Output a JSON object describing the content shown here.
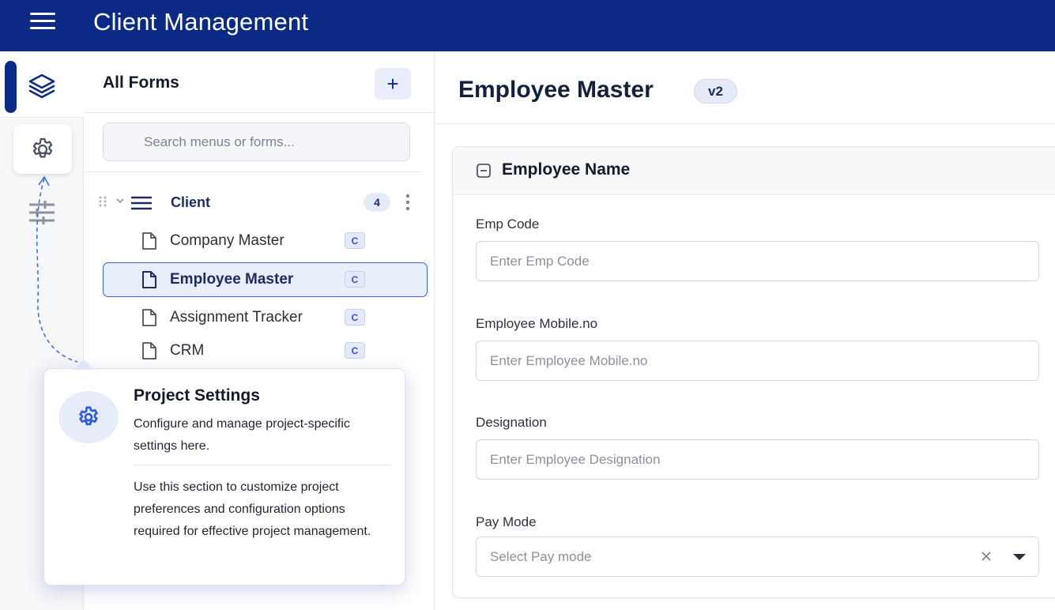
{
  "app": {
    "title": "Client Management"
  },
  "forms_panel": {
    "title": "All Forms",
    "add_label": "+",
    "search_placeholder": "Search menus or forms...",
    "group": {
      "label": "Client",
      "count": "4"
    },
    "items": [
      {
        "label": "Company Master",
        "badge": "C"
      },
      {
        "label": "Employee Master",
        "badge": "C",
        "active": true
      },
      {
        "label": "Assignment Tracker",
        "badge": "C"
      },
      {
        "label": "CRM",
        "badge": "C"
      }
    ]
  },
  "main": {
    "title": "Employee Master",
    "version": "v2",
    "section_title": "Employee Name",
    "fields": [
      {
        "label": "Emp Code",
        "placeholder": "Enter Emp Code"
      },
      {
        "label": "Employee Mobile.no",
        "placeholder": "Enter Employee Mobile.no"
      },
      {
        "label": "Designation",
        "placeholder": "Enter Employee Designation"
      }
    ],
    "select": {
      "label": "Pay Mode",
      "placeholder": "Select Pay mode"
    }
  },
  "tooltip": {
    "title": "Project Settings",
    "description": "Configure and manage project-specific settings here.",
    "body": "Use this section to customize project preferences and configuration options required for effective project management."
  },
  "icons": {
    "menu": "hamburger-icon",
    "layers": "layers-icon",
    "settings": "gear-icon",
    "filters": "sliders-icon",
    "document": "document-icon",
    "collapse": "minus-square-icon"
  },
  "colors": {
    "brand": "#0b2a85",
    "accent": "#3b63d6",
    "active_bg": "#e9eefb"
  }
}
